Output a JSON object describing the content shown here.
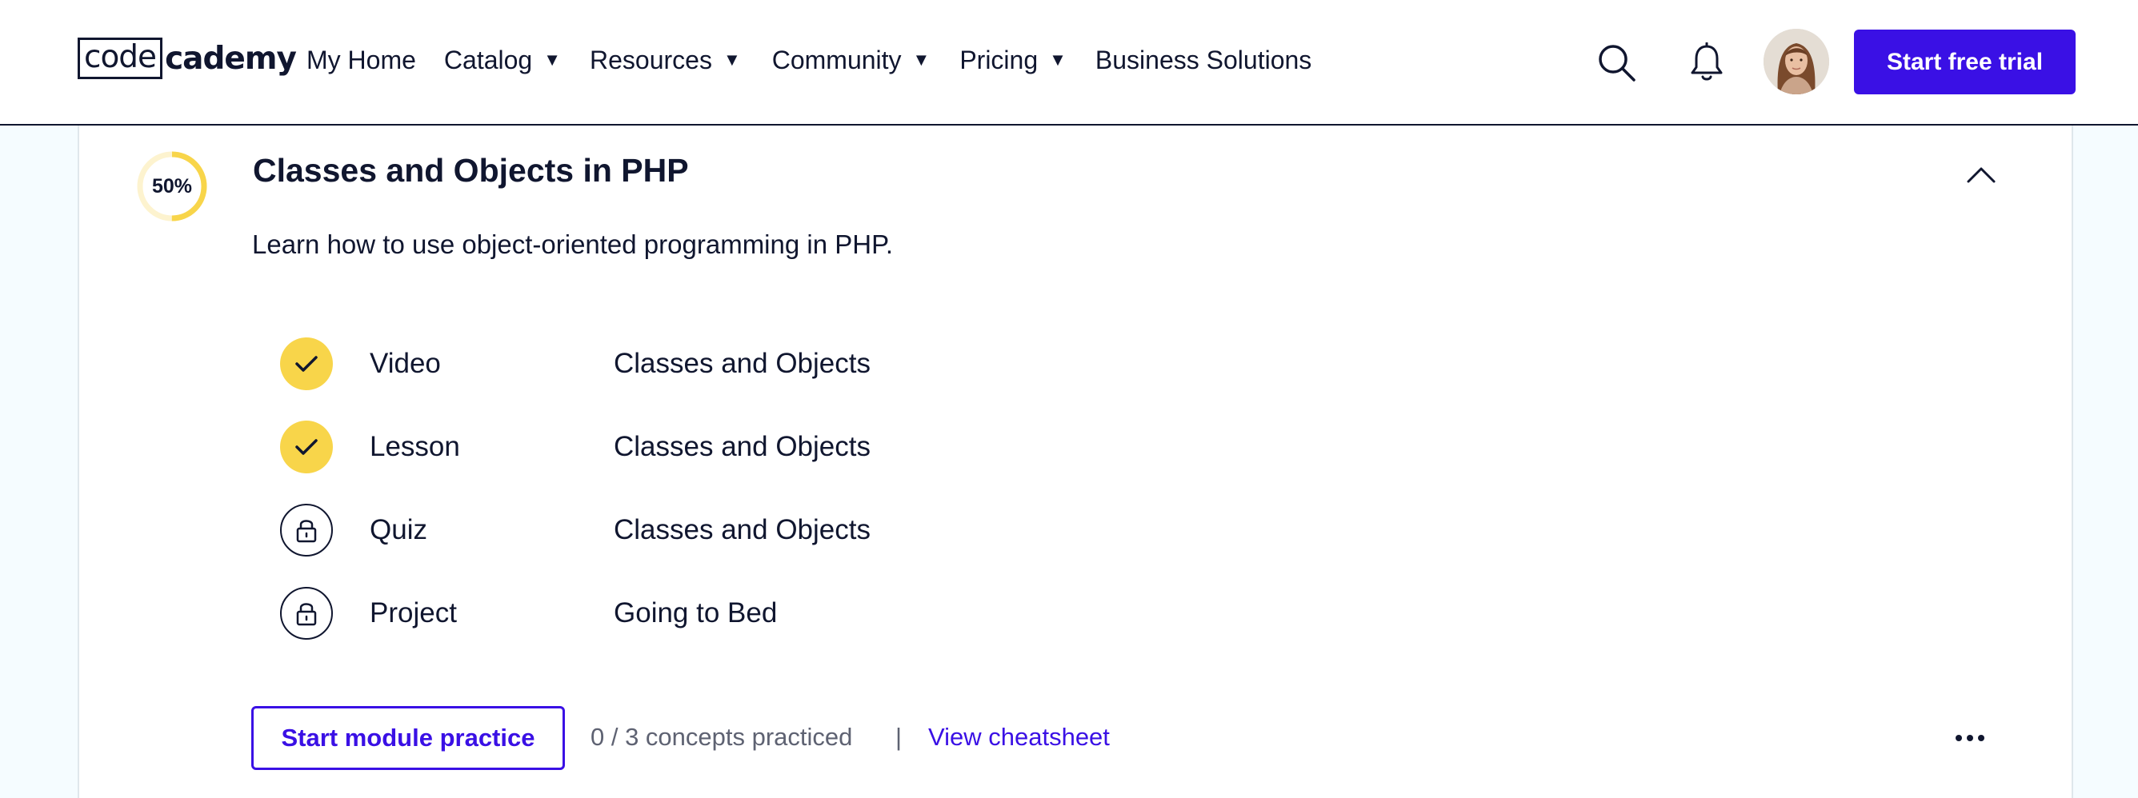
{
  "header": {
    "logo": {
      "boxed": "code",
      "rest": "cademy"
    },
    "nav": [
      {
        "label": "My Home",
        "dropdown": false
      },
      {
        "label": "Catalog",
        "dropdown": true
      },
      {
        "label": "Resources",
        "dropdown": true
      },
      {
        "label": "Community",
        "dropdown": true
      },
      {
        "label": "Pricing",
        "dropdown": true
      },
      {
        "label": "Business Solutions",
        "dropdown": false
      }
    ],
    "caret": "▼",
    "icons": {
      "search": "search-icon",
      "notifications": "bell-icon"
    },
    "cta_label": "Start free trial"
  },
  "module": {
    "progress_label": "50%",
    "progress_value": 0.5,
    "title": "Classes and Objects in PHP",
    "description": "Learn how to use object-oriented programming in PHP.",
    "items": [
      {
        "type": "Video",
        "name": "Classes and Objects",
        "status": "completed"
      },
      {
        "type": "Lesson",
        "name": "Classes and Objects",
        "status": "completed"
      },
      {
        "type": "Quiz",
        "name": "Classes and Objects",
        "status": "locked"
      },
      {
        "type": "Project",
        "name": "Going to Bed",
        "status": "locked"
      }
    ],
    "practice_button": "Start module practice",
    "concepts_text": "0 / 3 concepts practiced",
    "separator": "|",
    "cheatsheet_link": "View cheatsheet"
  },
  "colors": {
    "brand": "#3a10e5",
    "navy": "#10162f",
    "complete": "#f8d54a",
    "page_bg": "#f5fcff"
  }
}
